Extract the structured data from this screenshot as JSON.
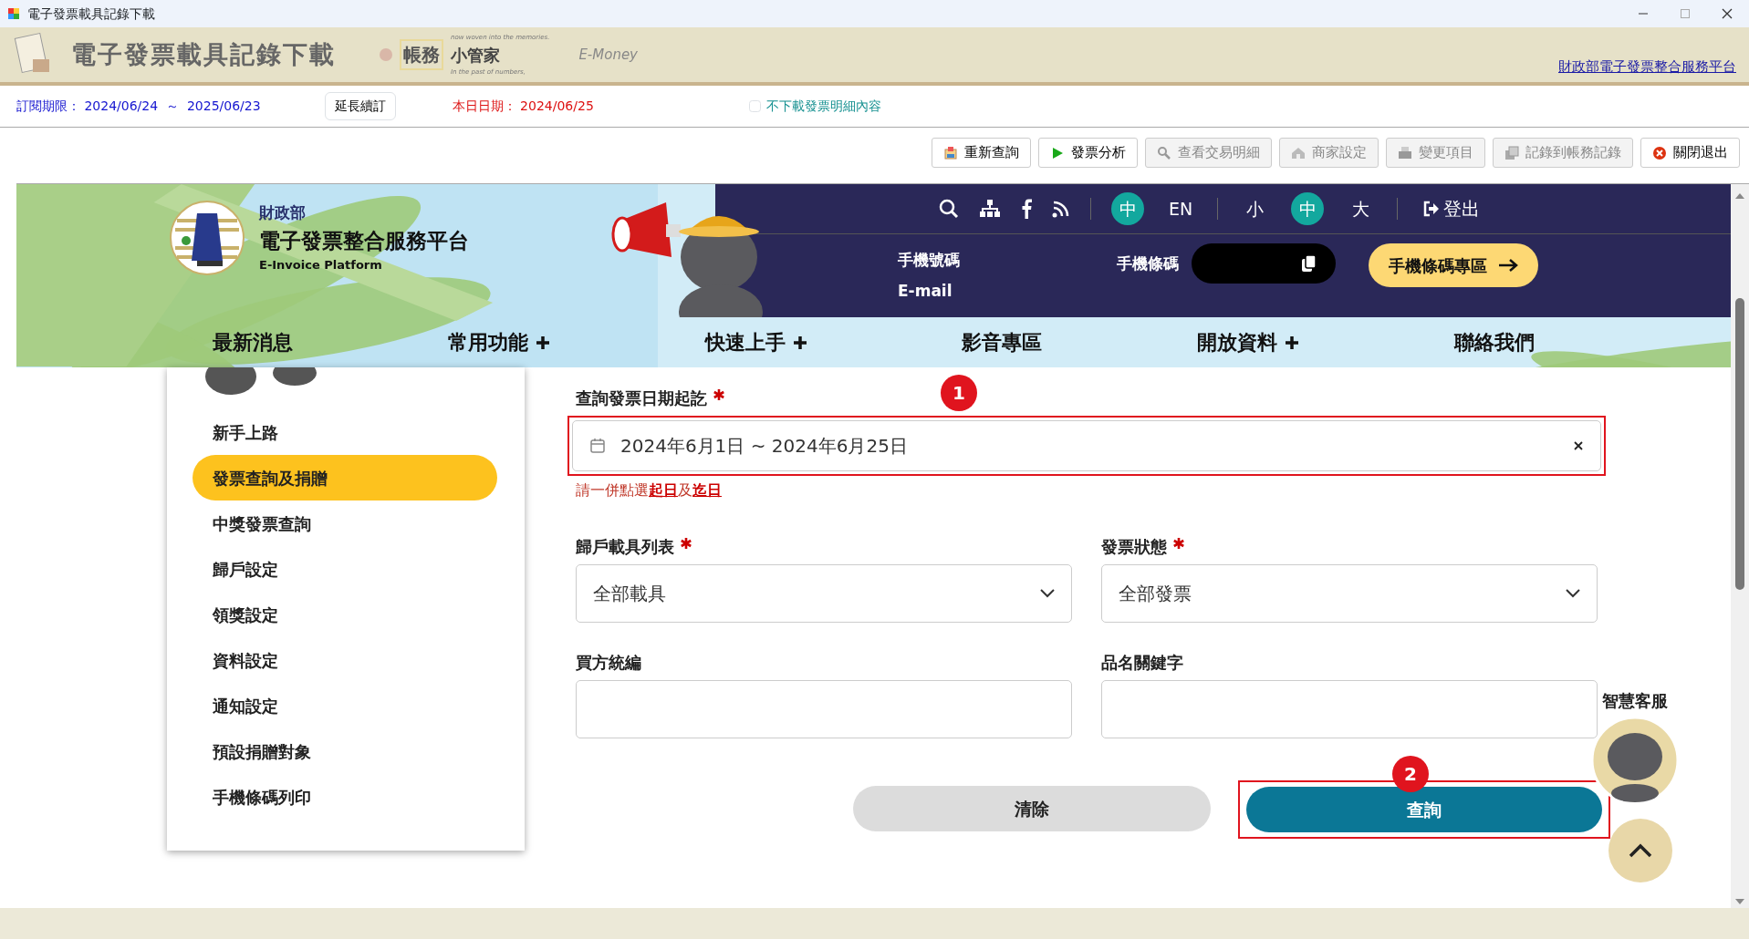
{
  "window": {
    "title": "電子發票載具記錄下載"
  },
  "app_header": {
    "title": "電子發票載具記錄下載",
    "brand_main": "帳務",
    "brand_sub": "小管家",
    "tag_top": "now woven into the memories.",
    "tag_bottom": "In the past of numbers,",
    "emoney": "E-Money",
    "link": "財政部電子發票整合服務平台"
  },
  "subscription": {
    "label": "訂閱期限：",
    "start": "2024/06/24",
    "separator": "～",
    "end": "2025/06/23",
    "renew_button": "延長續訂",
    "today_label": "本日日期：",
    "today": "2024/06/25",
    "skip_details": {
      "label": "不下載發票明細內容",
      "checked": false
    }
  },
  "toolbar": [
    {
      "label": "重新查詢",
      "kind": "refresh",
      "disabled": false
    },
    {
      "label": "發票分析",
      "kind": "play",
      "disabled": false
    },
    {
      "label": "查看交易明細",
      "kind": "search",
      "disabled": true
    },
    {
      "label": "商家設定",
      "kind": "house",
      "disabled": true
    },
    {
      "label": "變更項目",
      "kind": "printer",
      "disabled": true
    },
    {
      "label": "記錄到帳務記錄",
      "kind": "docs",
      "disabled": true
    },
    {
      "label": "關閉退出",
      "kind": "close",
      "disabled": false
    }
  ],
  "site": {
    "ministry": "財政部",
    "platform": "電子發票整合服務平台",
    "platform_en": "E-Invoice Platform",
    "language": [
      {
        "label": "中",
        "selected": true
      },
      {
        "label": "EN",
        "selected": false
      }
    ],
    "font_size": [
      {
        "label": "小",
        "selected": false
      },
      {
        "label": "中",
        "selected": true
      },
      {
        "label": "大",
        "selected": false
      }
    ],
    "logout": "登出",
    "phone_label": "手機號碼",
    "email_label": "E-mail",
    "barcode_label": "手機條碼",
    "barcode_zone": "手機條碼專區",
    "nav": [
      {
        "label": "最新消息",
        "expandable": false
      },
      {
        "label": "常用功能",
        "expandable": true
      },
      {
        "label": "快速上手",
        "expandable": true
      },
      {
        "label": "影音專區",
        "expandable": false
      },
      {
        "label": "開放資料",
        "expandable": true
      },
      {
        "label": "聯絡我們",
        "expandable": false
      }
    ]
  },
  "sidebar": {
    "items": [
      {
        "label": "新手上路",
        "selected": false
      },
      {
        "label": "發票查詢及捐贈",
        "selected": true
      },
      {
        "label": "中獎發票查詢",
        "selected": false
      },
      {
        "label": "歸戶設定",
        "selected": false
      },
      {
        "label": "領獎設定",
        "selected": false
      },
      {
        "label": "資料設定",
        "selected": false
      },
      {
        "label": "通知設定",
        "selected": false
      },
      {
        "label": "預設捐贈對象",
        "selected": false
      },
      {
        "label": "手機條碼列印",
        "selected": false
      }
    ]
  },
  "form": {
    "date_range": {
      "label": "查詢發票日期起訖",
      "required": true,
      "value": "2024年6月1日 ~ 2024年6月25日",
      "step": "1"
    },
    "hint": "請一併點選**起日**及**迄日**",
    "selects": [
      {
        "label": "歸戶載具列表",
        "required": true,
        "value": "全部載具"
      },
      {
        "label": "發票狀態",
        "required": true,
        "value": "全部發票"
      }
    ],
    "inputs": [
      {
        "label": "買方統編",
        "required": false
      },
      {
        "label": "品名關鍵字",
        "required": false
      }
    ],
    "clear_button": "清除",
    "query_button": {
      "label": "查詢",
      "step": "2"
    }
  },
  "chatbot": {
    "label": "智慧客服"
  }
}
